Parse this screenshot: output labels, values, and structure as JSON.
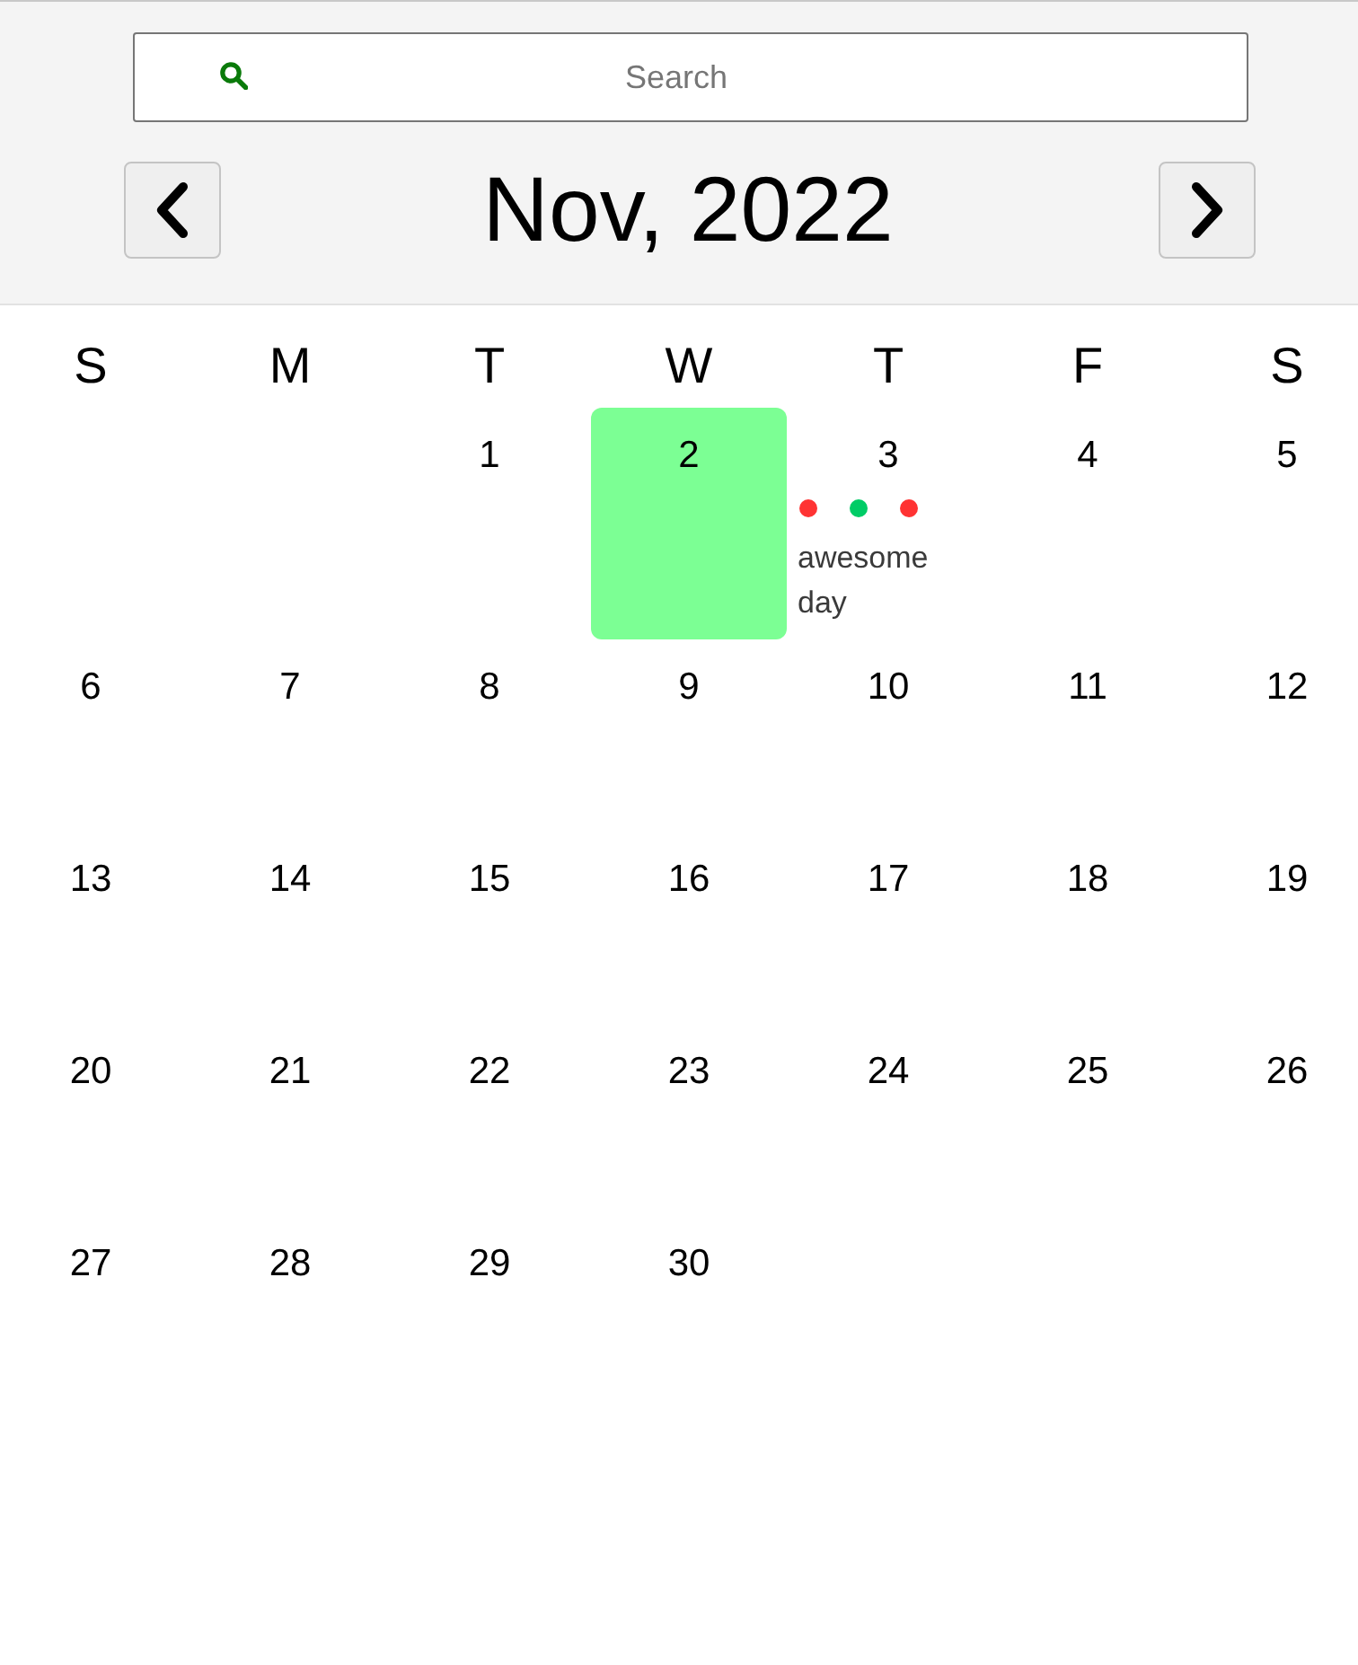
{
  "search": {
    "placeholder": "Search"
  },
  "header": {
    "title": "Nov, 2022"
  },
  "weekdays": [
    "S",
    "M",
    "T",
    "W",
    "T",
    "F",
    "S"
  ],
  "weeks": [
    [
      {
        "day": "1",
        "selected": false
      },
      {
        "day": "2",
        "selected": true
      },
      {
        "day": "3",
        "selected": false,
        "markers": [
          {
            "color": "#ff3333"
          },
          {
            "color": "#00cc66"
          },
          {
            "color": "#ff3333"
          }
        ],
        "note": "awesome day"
      },
      {
        "day": "4",
        "selected": false
      },
      {
        "day": "5",
        "selected": false
      }
    ],
    [
      {
        "day": "6",
        "selected": false
      },
      {
        "day": "7",
        "selected": false
      },
      {
        "day": "8",
        "selected": false
      },
      {
        "day": "9",
        "selected": false
      },
      {
        "day": "10",
        "selected": false
      },
      {
        "day": "11",
        "selected": false
      },
      {
        "day": "12",
        "selected": false
      }
    ],
    [
      {
        "day": "13",
        "selected": false
      },
      {
        "day": "14",
        "selected": false
      },
      {
        "day": "15",
        "selected": false
      },
      {
        "day": "16",
        "selected": false
      },
      {
        "day": "17",
        "selected": false
      },
      {
        "day": "18",
        "selected": false
      },
      {
        "day": "19",
        "selected": false
      }
    ],
    [
      {
        "day": "20",
        "selected": false
      },
      {
        "day": "21",
        "selected": false
      },
      {
        "day": "22",
        "selected": false
      },
      {
        "day": "23",
        "selected": false
      },
      {
        "day": "24",
        "selected": false
      },
      {
        "day": "25",
        "selected": false
      },
      {
        "day": "26",
        "selected": false
      }
    ],
    [
      {
        "day": "27",
        "selected": false
      },
      {
        "day": "28",
        "selected": false
      },
      {
        "day": "29",
        "selected": false
      },
      {
        "day": "30",
        "selected": false
      }
    ]
  ]
}
